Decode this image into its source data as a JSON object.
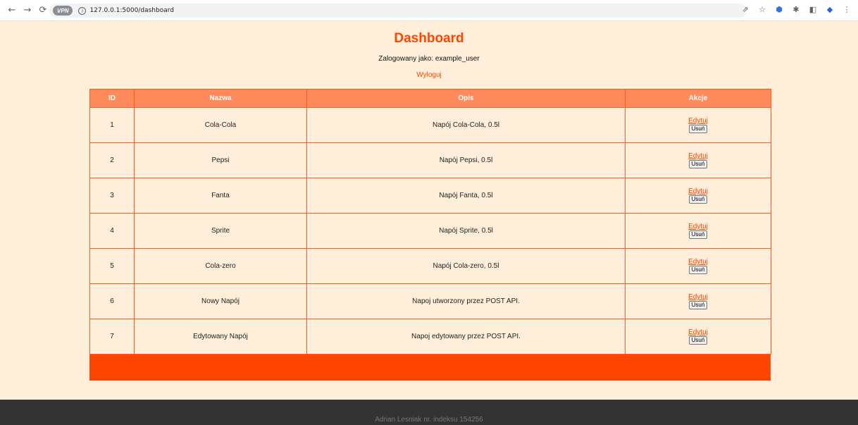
{
  "browser": {
    "url": "127.0.0.1:5000/dashboard",
    "vpn_label": "VPN"
  },
  "page": {
    "title": "Dashboard",
    "logged_in_as": "Zalogowany jako: example_user",
    "logout_label": "Wyloguj"
  },
  "table": {
    "headers": [
      "ID",
      "Nazwa",
      "Opis",
      "Akcje"
    ],
    "edit_label": "Edytuj",
    "delete_label": "Usuń",
    "rows": [
      {
        "id": "1",
        "name": "Cola-Cola",
        "desc": "Napój Cola-Cola, 0.5l"
      },
      {
        "id": "2",
        "name": "Pepsi",
        "desc": "Napój Pepsi, 0.5l"
      },
      {
        "id": "3",
        "name": "Fanta",
        "desc": "Napój Fanta, 0.5l"
      },
      {
        "id": "4",
        "name": "Sprite",
        "desc": "Napój Sprite, 0.5l"
      },
      {
        "id": "5",
        "name": "Cola-zero",
        "desc": "Napój Cola-zero, 0.5l"
      },
      {
        "id": "6",
        "name": "Nowy Napój",
        "desc": "Napoj utworzony przez POST API."
      },
      {
        "id": "7",
        "name": "Edytowany Napój",
        "desc": "Napoj edytowany przez POST API."
      }
    ]
  },
  "footer": {
    "text": "Adrian Lesniak nr. indeksu 154256"
  },
  "colors": {
    "accent": "#ff4500",
    "header_bg": "#ff8a5c",
    "page_bg": "#ffeed9",
    "footer_bg": "#333333"
  }
}
